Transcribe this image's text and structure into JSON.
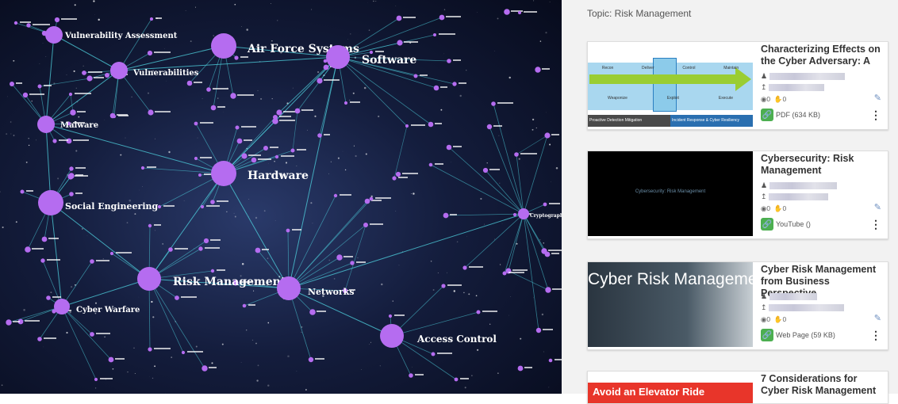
{
  "graph": {
    "nodes": [
      {
        "label": "Vulnerability Assessment"
      },
      {
        "label": "Air Force Systems"
      },
      {
        "label": "Software"
      },
      {
        "label": "Vulnerabilities"
      },
      {
        "label": "Malware"
      },
      {
        "label": "Hardware"
      },
      {
        "label": "Social Engineering"
      },
      {
        "label": "Cryptography"
      },
      {
        "label": "Risk Management"
      },
      {
        "label": "Networks"
      },
      {
        "label": "Cyber Warfare"
      },
      {
        "label": "Access Control"
      }
    ]
  },
  "panel": {
    "topic": "Topic: Risk Management",
    "cards": [
      {
        "title": "Characterizing Effects on the Cyber Adversary: A",
        "link_label": "PDF (634 KB)",
        "views": "0",
        "likes": "0",
        "thumb": {
          "phases_top": [
            "Recon",
            "Deliver",
            "Control",
            "Maintain"
          ],
          "phases_bottom": [
            "Weaponize",
            "Exploit",
            "Execute"
          ],
          "footer_left": "Proactive Detection Mitigation",
          "footer_right": "Incident Response & Cyber Resiliency"
        }
      },
      {
        "title": "Cybersecurity: Risk Management",
        "link_label": "YouTube ()",
        "views": "0",
        "likes": "0",
        "thumb": {
          "text": "Cybersecurity: Risk Management"
        }
      },
      {
        "title": "Cyber Risk Management from Business Perspective",
        "link_label": "Web Page (59 KB)",
        "views": "0",
        "likes": "0",
        "thumb": {
          "text": "Cyber Risk Management"
        }
      },
      {
        "title": "7 Considerations for Cyber Risk Management",
        "thumb": {
          "text": "Avoid an Elevator Ride"
        }
      }
    ]
  },
  "colors": {
    "node": "#b56cf0",
    "edge": "#4fd3e0",
    "link_icon": "#4caf50",
    "arrow": "#9acd32",
    "thumb_blue": "#a9d7ef"
  }
}
